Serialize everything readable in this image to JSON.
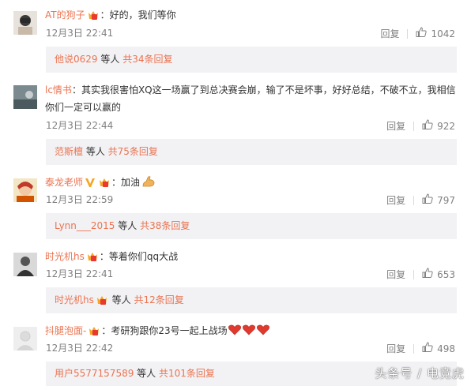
{
  "comments": [
    {
      "user": "AT的狗子",
      "text": "好的，我们等你",
      "time": "12月3日 22:41",
      "reply_label": "回复",
      "likes": "1042",
      "sub_user": "他说0629",
      "sub_mid": " 等人 ",
      "sub_count": "共34条回复",
      "avatar_icon": "avatar-icon"
    },
    {
      "user": "lc情书",
      "text": "其实我很害怕XQ这一场赢了到总决赛会崩，输了不是坏事，好好总结，不破不立，我相信你们一定可以赢的",
      "time": "12月3日 22:44",
      "reply_label": "回复",
      "likes": "922",
      "sub_user": "范斯檀",
      "sub_mid": " 等人 ",
      "sub_count": "共75条回复",
      "avatar_icon": "avatar-icon"
    },
    {
      "user": "泰龙老师",
      "text": "加油",
      "time": "12月3日 22:59",
      "reply_label": "回复",
      "likes": "797",
      "sub_user": "Lynn___2015",
      "sub_mid": " 等人 ",
      "sub_count": "共38条回复",
      "avatar_icon": "avatar-icon",
      "emoji": "muscle-emoji"
    },
    {
      "user": "时光机hs",
      "text": "等着你们qq大战",
      "time": "12月3日 22:41",
      "reply_label": "回复",
      "likes": "653",
      "sub_user": "时光机hs",
      "sub_mid": " 等人 ",
      "sub_count": "共12条回复",
      "avatar_icon": "avatar-icon"
    },
    {
      "user": "抖腿泡面-",
      "text": "考研狗跟你23号一起上战场",
      "time": "12月3日 22:42",
      "reply_label": "回复",
      "likes": "498",
      "sub_user": "用户5577157589",
      "sub_mid": " 等人 ",
      "sub_count": "共101条回复",
      "avatar_icon": "avatar-icon",
      "emoji": "heart-emoji"
    }
  ],
  "colors": {
    "username": "#eb7350",
    "subbox_bg": "#f2f2f5",
    "muted": "#808080"
  },
  "watermark": "头条号 / 电竞虎"
}
